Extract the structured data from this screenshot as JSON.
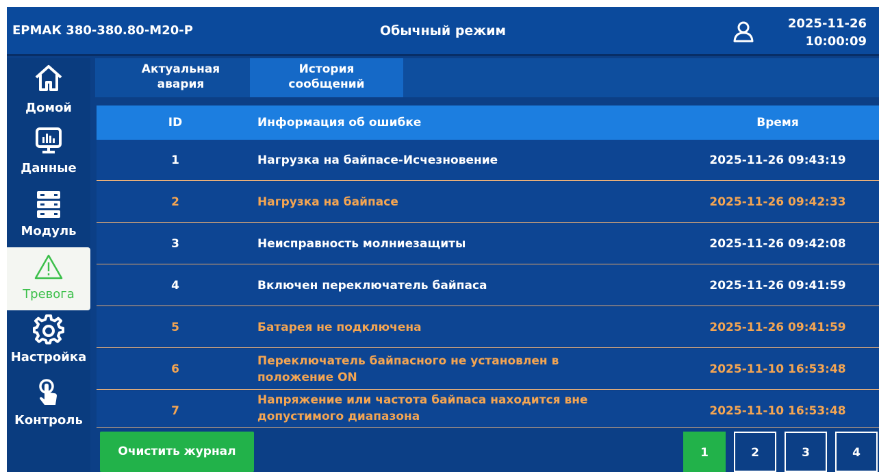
{
  "header": {
    "model": "ЕРМАК 380-380.80-M20-P",
    "mode": "Обычный режим",
    "date": "2025-11-26",
    "time": "10:00:09",
    "user_icon": "user-icon"
  },
  "sidebar": {
    "items": [
      {
        "label": "Домой",
        "icon": "home-icon"
      },
      {
        "label": "Данные",
        "icon": "monitor-chart-icon"
      },
      {
        "label": "Модуль",
        "icon": "server-module-icon"
      },
      {
        "label": "Тревога",
        "icon": "warning-triangle-icon",
        "active": true
      },
      {
        "label": "Настройка",
        "icon": "gear-icon"
      },
      {
        "label": "Контроль",
        "icon": "touch-hand-icon"
      }
    ]
  },
  "tabs": {
    "alarm": "Актуальная\nавария",
    "history": "История\nсообщений"
  },
  "table": {
    "headers": {
      "id": "ID",
      "info": "Информация об ошибке",
      "time": "Время"
    },
    "rows": [
      {
        "id": "1",
        "info": "Нагрузка на байпасе-Исчезновение",
        "time": "2025-11-26 09:43:19",
        "level": "normal"
      },
      {
        "id": "2",
        "info": "Нагрузка на байпасе",
        "time": "2025-11-26 09:42:33",
        "level": "warning"
      },
      {
        "id": "3",
        "info": "Неисправность молниезащиты",
        "time": "2025-11-26 09:42:08",
        "level": "normal"
      },
      {
        "id": "4",
        "info": "Включен переключатель байпаса",
        "time": "2025-11-26 09:41:59",
        "level": "normal"
      },
      {
        "id": "5",
        "info": "Батарея не подключена",
        "time": "2025-11-26 09:41:59",
        "level": "warning"
      },
      {
        "id": "6",
        "info_line1": "Переключатель байпасного не установлен в",
        "info_line2": "положение ON",
        "time": "2025-11-10 16:53:48",
        "level": "warning"
      },
      {
        "id": "7",
        "info_line1": "Напряжение или частота байпаса находится вне",
        "info_line2": "допустимого диапазона",
        "time": "2025-11-10 16:53:48",
        "level": "warning"
      }
    ]
  },
  "footer": {
    "clear_label": "Очистить журнал",
    "pages": [
      "1",
      "2",
      "3",
      "4"
    ],
    "current_page": "1"
  },
  "colors": {
    "background": "#0c3f86",
    "header_row": "#1c7ee0",
    "warning_text": "#f4a552",
    "active_green": "#22b24a"
  }
}
